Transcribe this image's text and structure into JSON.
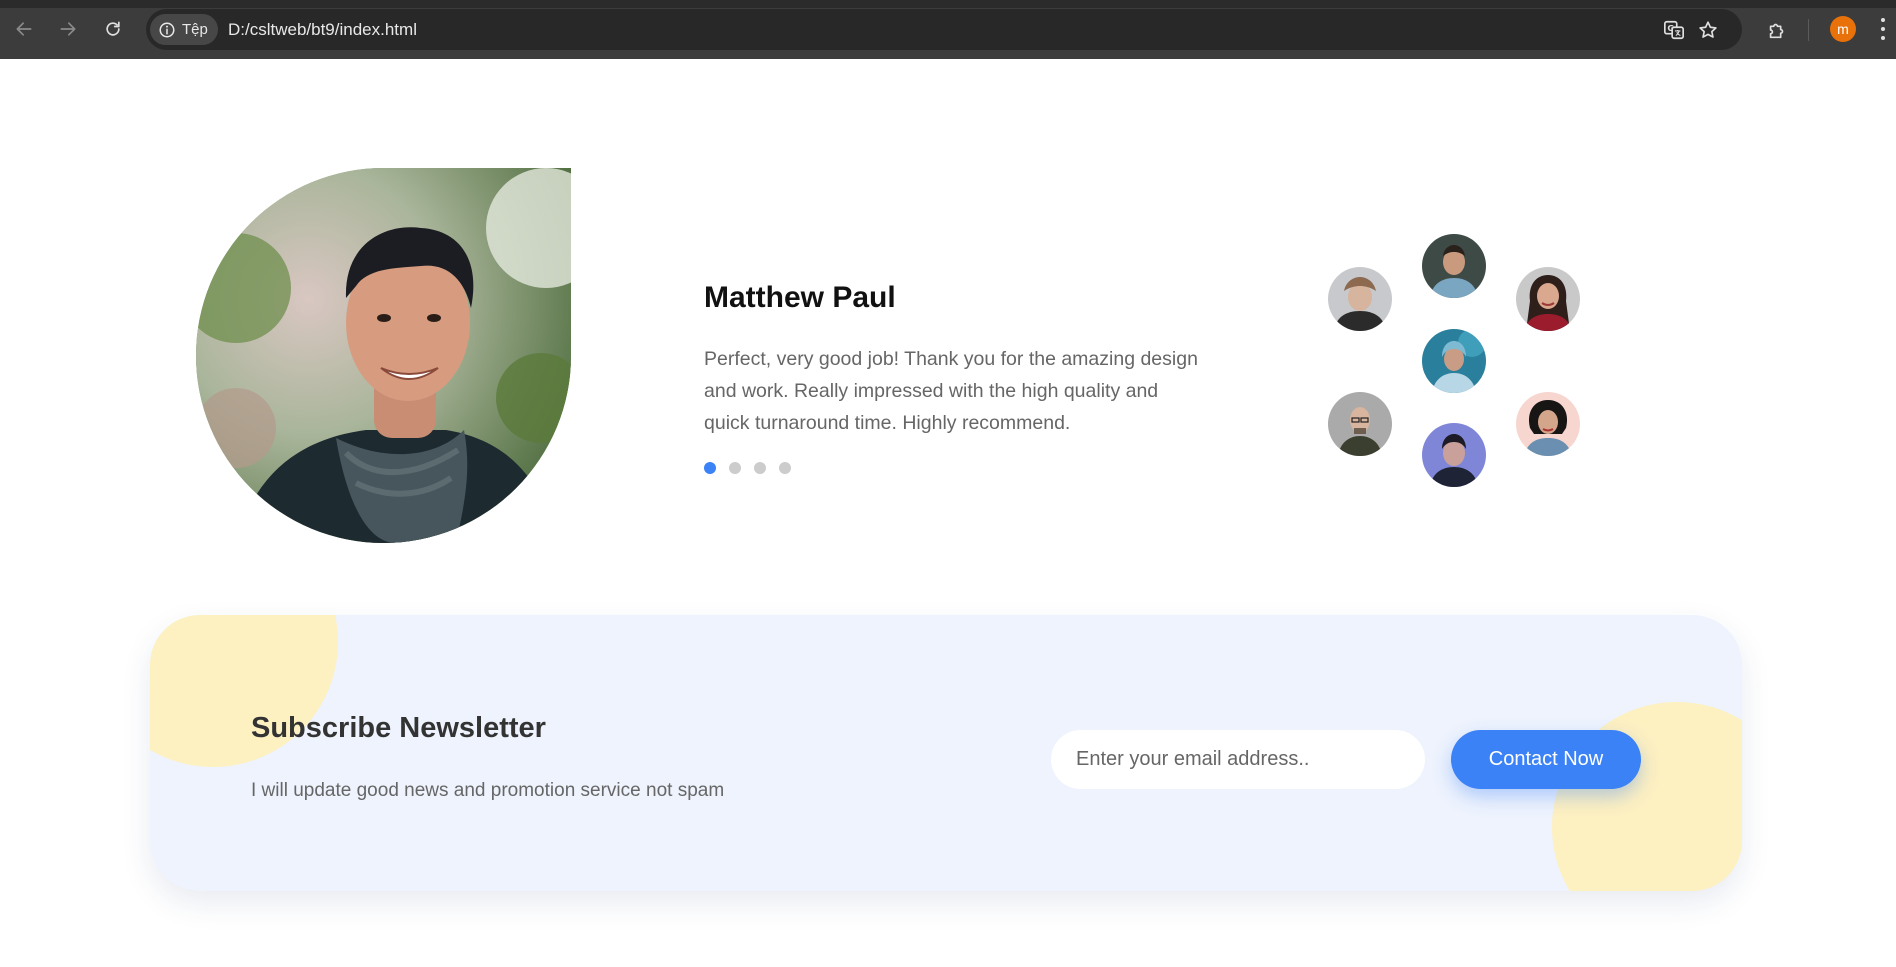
{
  "browser": {
    "site_label": "Tệp",
    "url": "D:/csltweb/bt9/index.html",
    "profile_initial": "m",
    "icons": {
      "back": "arrow-left-icon",
      "forward": "arrow-right-icon",
      "reload": "reload-icon",
      "site_info": "info-icon",
      "translate": "translate-icon",
      "bookmark": "star-icon",
      "extensions": "puzzle-icon",
      "menu": "kebab-menu-icon"
    }
  },
  "testimonial": {
    "name": "Matthew Paul",
    "quote": "Perfect, very good job! Thank you for the amazing design and work. Really impressed with the high quality and quick turnaround time. Highly recommend.",
    "slides_total": 4,
    "active_slide": 1,
    "avatars_count": 7
  },
  "newsletter": {
    "title": "Subscribe Newsletter",
    "subtitle": "I will update good news and promotion service not spam",
    "email_placeholder": "Enter your email address..",
    "email_value": "",
    "button_label": "Contact Now"
  },
  "colors": {
    "accent": "#3b82f6",
    "dot_inactive": "#cccccc",
    "newsletter_bg": "#eef3fd",
    "blob": "#fdf0c1",
    "chrome_bg": "#3c3c3c",
    "profile": "#e8710a"
  }
}
